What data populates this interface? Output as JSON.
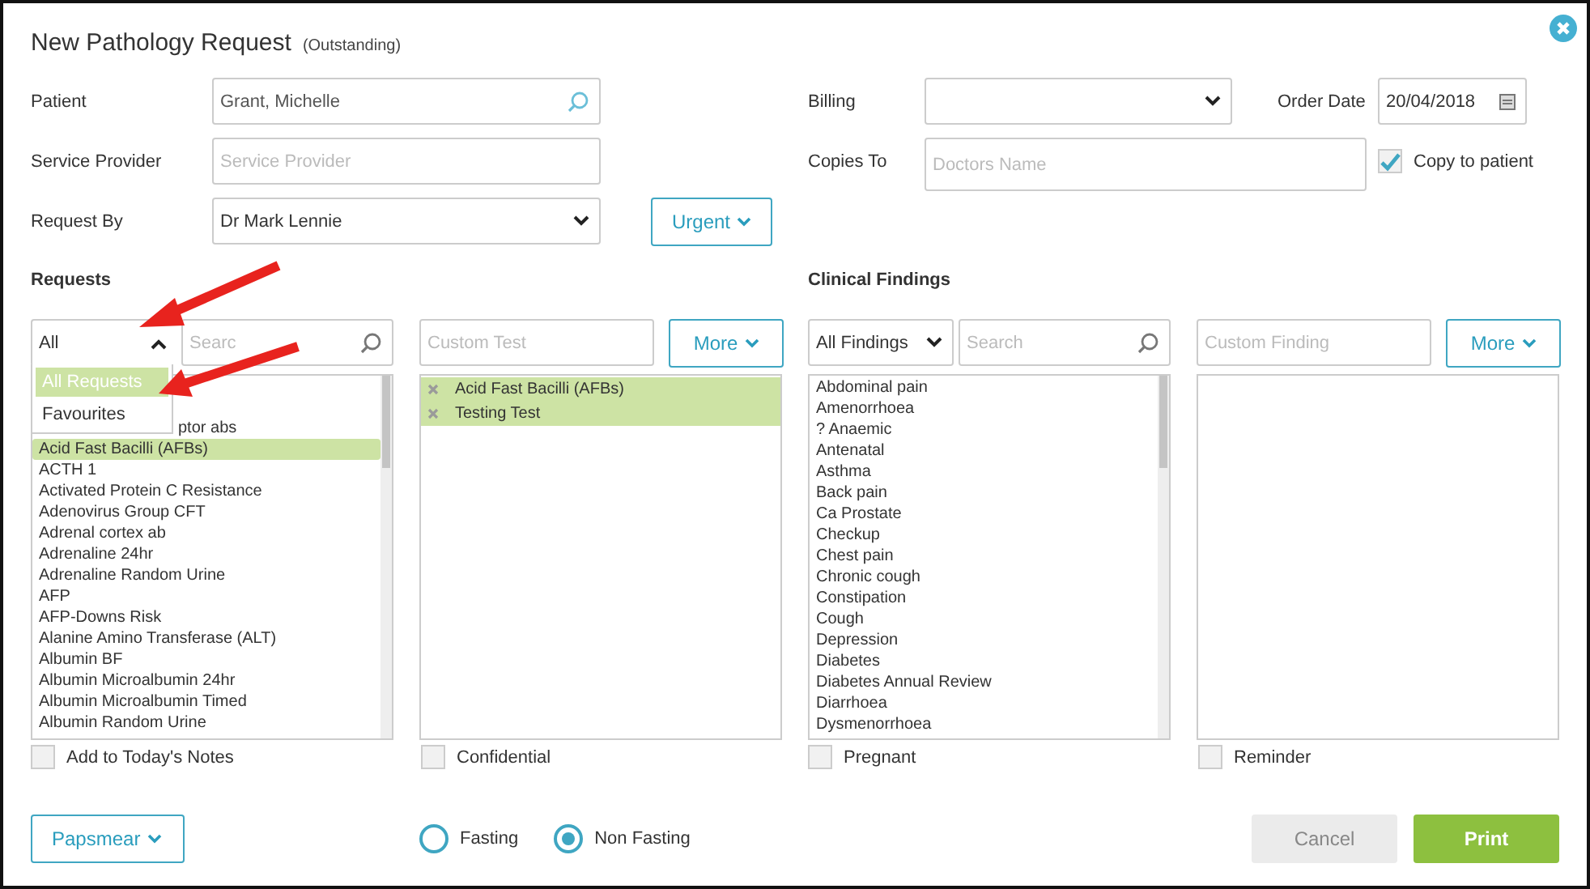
{
  "dialog": {
    "title": "New Pathology Request",
    "status": "(Outstanding)"
  },
  "patient": {
    "label": "Patient",
    "value": "Grant, Michelle"
  },
  "service_provider": {
    "label": "Service Provider",
    "placeholder": "Service Provider"
  },
  "request_by": {
    "label": "Request By",
    "value": "Dr Mark Lennie"
  },
  "urgent_button": "Urgent",
  "billing": {
    "label": "Billing"
  },
  "order_date": {
    "label": "Order Date",
    "value": "20/04/2018"
  },
  "copies_to": {
    "label": "Copies To",
    "placeholder": "Doctors Name"
  },
  "copy_to_patient": {
    "label": "Copy to patient",
    "checked": true
  },
  "requests": {
    "heading": "Requests",
    "filter": {
      "value": "All",
      "expanded": true,
      "options": [
        {
          "label": "All Requests",
          "selected": true
        },
        {
          "label": "Favourites",
          "selected": false
        }
      ]
    },
    "search": {
      "placeholder": "Searc"
    },
    "custom": {
      "placeholder": "Custom Test"
    },
    "more_button": "More",
    "items": [
      {
        "text": "ptor abs",
        "kind": "covered",
        "selected": false
      },
      {
        "text": "Acid Fast Bacilli (AFBs)",
        "kind": "item",
        "selected": true
      },
      {
        "text": "ACTH 1",
        "kind": "item",
        "selected": false
      },
      {
        "text": "Activated Protein C Resistance",
        "kind": "item",
        "selected": false
      },
      {
        "text": "Adenovirus Group CFT",
        "kind": "item",
        "selected": false
      },
      {
        "text": "Adrenal cortex ab",
        "kind": "item",
        "selected": false
      },
      {
        "text": "Adrenaline 24hr",
        "kind": "item",
        "selected": false
      },
      {
        "text": "Adrenaline Random Urine",
        "kind": "item",
        "selected": false
      },
      {
        "text": "AFP",
        "kind": "item",
        "selected": false
      },
      {
        "text": "AFP-Downs Risk",
        "kind": "item",
        "selected": false
      },
      {
        "text": "Alanine Amino Transferase (ALT)",
        "kind": "item",
        "selected": false
      },
      {
        "text": "Albumin BF",
        "kind": "item",
        "selected": false
      },
      {
        "text": "Albumin Microalbumin 24hr",
        "kind": "item",
        "selected": false
      },
      {
        "text": "Albumin Microalbumin Timed",
        "kind": "item",
        "selected": false
      },
      {
        "text": "Albumin Random Urine",
        "kind": "item",
        "selected": false
      }
    ],
    "chosen": [
      "Acid Fast Bacilli (AFBs)",
      "Testing Test"
    ],
    "add_to_notes": {
      "label": "Add to Today's Notes",
      "checked": false
    },
    "confidential": {
      "label": "Confidential",
      "checked": false
    }
  },
  "findings": {
    "heading": "Clinical Findings",
    "filter": {
      "value": "All Findings",
      "expanded": false
    },
    "search": {
      "placeholder": "Search"
    },
    "custom": {
      "placeholder": "Custom Finding"
    },
    "more_button": "More",
    "items": [
      {
        "text": "Abdominal pain",
        "kind": "item",
        "selected": false
      },
      {
        "text": "Amenorrhoea",
        "kind": "item",
        "selected": false
      },
      {
        "text": "? Anaemic",
        "kind": "item",
        "selected": false
      },
      {
        "text": "Antenatal",
        "kind": "item",
        "selected": false
      },
      {
        "text": "Asthma",
        "kind": "item",
        "selected": false
      },
      {
        "text": "Back pain",
        "kind": "item",
        "selected": false
      },
      {
        "text": "Ca Prostate",
        "kind": "item",
        "selected": false
      },
      {
        "text": "Checkup",
        "kind": "item",
        "selected": false
      },
      {
        "text": "Chest pain",
        "kind": "item",
        "selected": false
      },
      {
        "text": "Chronic cough",
        "kind": "item",
        "selected": false
      },
      {
        "text": "Constipation",
        "kind": "item",
        "selected": false
      },
      {
        "text": "Cough",
        "kind": "item",
        "selected": false
      },
      {
        "text": "Depression",
        "kind": "item",
        "selected": false
      },
      {
        "text": "Diabetes",
        "kind": "item",
        "selected": false
      },
      {
        "text": "Diabetes Annual Review",
        "kind": "item",
        "selected": false
      },
      {
        "text": "Diarrhoea",
        "kind": "item",
        "selected": false
      },
      {
        "text": "Dysmenorrhoea",
        "kind": "item",
        "selected": false
      }
    ],
    "pregnant": {
      "label": "Pregnant",
      "checked": false
    },
    "reminder": {
      "label": "Reminder",
      "checked": false
    }
  },
  "papsmear_button": "Papsmear",
  "fasting": [
    {
      "label": "Fasting",
      "selected": false
    },
    {
      "label": "Non Fasting",
      "selected": true
    }
  ],
  "buttons": [
    {
      "label": "Cancel",
      "kind": "secondary"
    },
    {
      "label": "Print",
      "kind": "primary"
    }
  ],
  "annotations": [
    {
      "kind": "arrow"
    },
    {
      "kind": "arrow"
    }
  ]
}
